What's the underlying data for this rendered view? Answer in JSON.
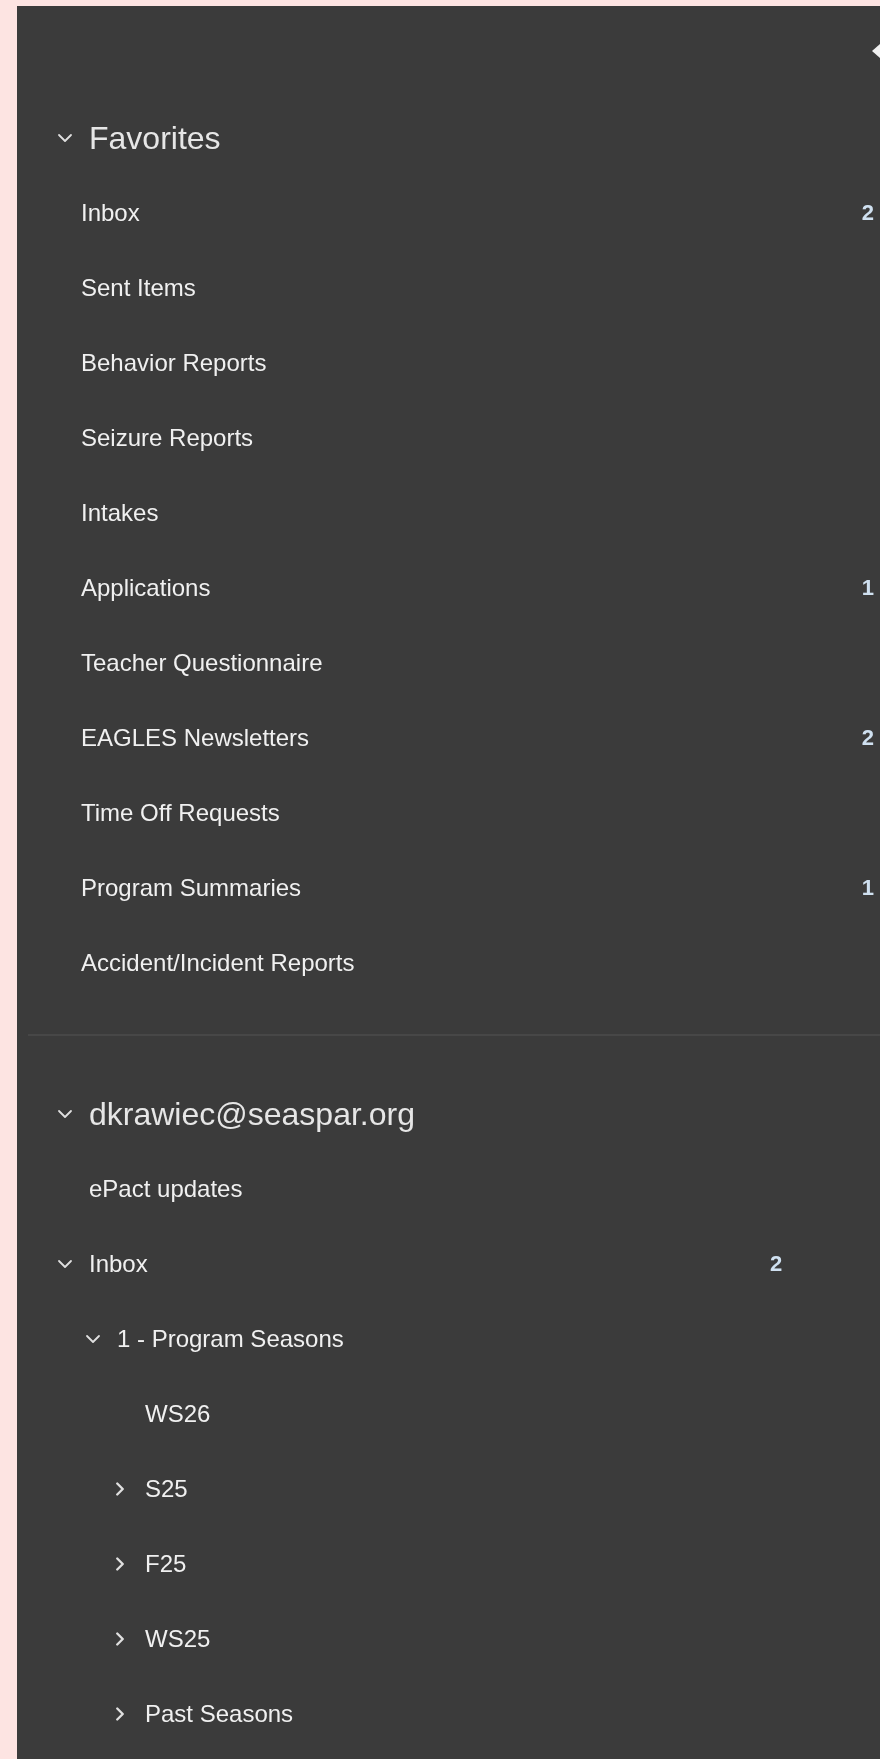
{
  "favorites": {
    "title": "Favorites",
    "expanded": true,
    "items": [
      {
        "label": "Inbox",
        "count": "2"
      },
      {
        "label": "Sent Items"
      },
      {
        "label": "Behavior Reports"
      },
      {
        "label": "Seizure Reports"
      },
      {
        "label": "Intakes"
      },
      {
        "label": "Applications",
        "count": "1"
      },
      {
        "label": "Teacher Questionnaire"
      },
      {
        "label": "EAGLES Newsletters",
        "count": "2"
      },
      {
        "label": "Time Off Requests"
      },
      {
        "label": "Program Summaries",
        "count": "1"
      },
      {
        "label": "Accident/Incident Reports"
      }
    ]
  },
  "account": {
    "title": "dkrawiec@seaspar.org",
    "expanded": true,
    "folders": [
      {
        "label": "ePact updates"
      },
      {
        "label": "Inbox",
        "count": "2",
        "expanded": true,
        "children": [
          {
            "label": "1 - Program Seasons",
            "expanded": true,
            "children": [
              {
                "label": "WS26"
              },
              {
                "label": "S25",
                "expanded": false
              },
              {
                "label": "F25",
                "expanded": false
              },
              {
                "label": "WS25",
                "expanded": false
              },
              {
                "label": "Past Seasons",
                "expanded": false
              }
            ]
          }
        ]
      }
    ]
  }
}
